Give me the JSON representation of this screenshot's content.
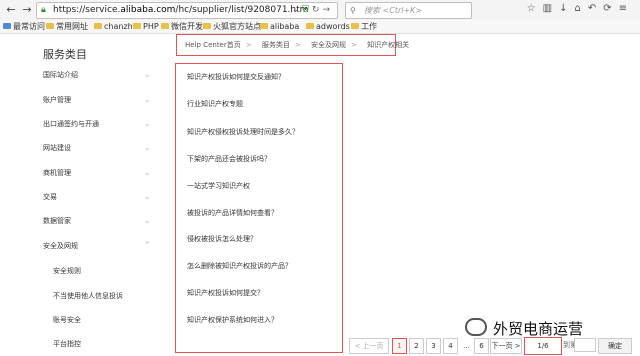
{
  "browser": {
    "url_prefix": "https://service.",
    "url_host": "alibaba.com",
    "url_path": "/hc/supplier/list/9208071.htm",
    "search_placeholder": "搜索 <Ctrl+K>",
    "bookmarks": [
      "最常访问",
      "常用网址",
      "chanzhi",
      "PHP",
      "微信开发",
      "火狐官方站点",
      "alibaba",
      "adwords",
      "工作"
    ]
  },
  "sidebar": {
    "title": "服务类目",
    "items": [
      {
        "label": "国际站介绍",
        "chev": "⌄"
      },
      {
        "label": "账户管理",
        "chev": "⌄"
      },
      {
        "label": "出口通签约与开通",
        "chev": "⌄"
      },
      {
        "label": "网站建设",
        "chev": "⌄"
      },
      {
        "label": "商机管理",
        "chev": "⌄"
      },
      {
        "label": "交易",
        "chev": "⌄"
      },
      {
        "label": "数据管家",
        "chev": "⌄"
      },
      {
        "label": "安全及网规",
        "chev": "⌃"
      }
    ],
    "subitems": [
      "安全规则",
      "不当使用他人信息投诉",
      "账号安全",
      "平台指控"
    ]
  },
  "breadcrumb": [
    "Help Center首页",
    "服务类目",
    "安全及网规",
    "知识产权相关"
  ],
  "questions": [
    "知识产权投诉如何提交反通知？",
    "行业知识产权专题",
    "知识产权侵权投诉处理时间是多久？",
    "下架的产品还会被投诉吗？",
    "一站式学习知识产权",
    "被投诉的产品详情如何查看？",
    "侵权被投诉怎么处理？",
    "怎么删除被知识产权投诉的产品？",
    "知识产权投诉如何提交？",
    "知识产权保护系统如何进入？"
  ],
  "pagination": {
    "prev": "< 上一页",
    "pages": [
      "1",
      "2",
      "3",
      "4",
      "...",
      "6"
    ],
    "next": "下一页 >",
    "current": "1/6",
    "goto_label": "到第",
    "confirm": "确定"
  },
  "watermark": "外贸电商运营"
}
